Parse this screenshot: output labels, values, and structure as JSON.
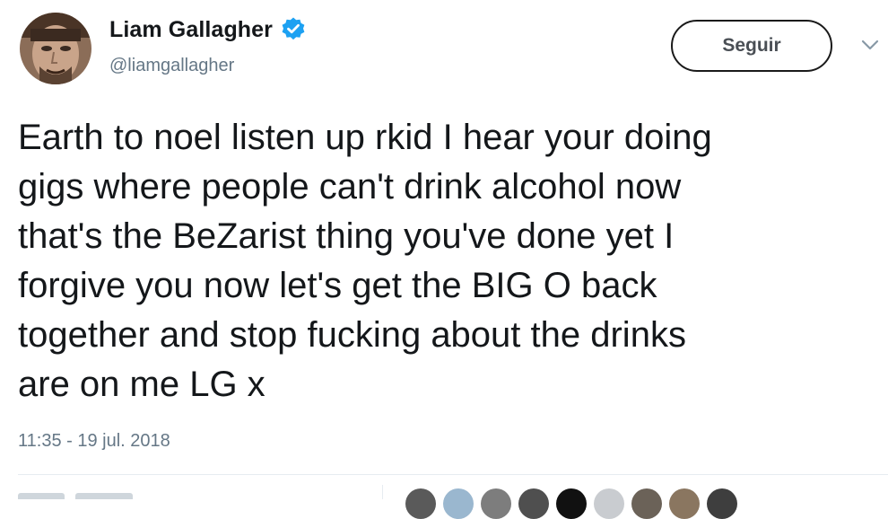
{
  "tweet": {
    "display_name": "Liam Gallagher",
    "handle": "@liamgallagher",
    "follow_label": "Seguir",
    "text": "Earth to noel listen up rkid I hear your doing\ngigs where people can't drink alcohol now\nthat's the BeZarist thing you've done yet I\nforgive you now let's get the BIG O back\ntogether and stop fucking about the drinks\nare on me LG x",
    "timestamp": "11:35 - 19 jul. 2018"
  },
  "icons": {
    "verified": "verified-badge-icon",
    "more": "chevron-down-icon"
  },
  "colors": {
    "verified_blue": "#1da1f2",
    "secondary_text": "#657786",
    "primary_text": "#14171a"
  },
  "likers": [
    {
      "color": "#5a5a5a"
    },
    {
      "color": "#9ab7cf"
    },
    {
      "color": "#7d7d7d"
    },
    {
      "color": "#4f4f4f"
    },
    {
      "color": "#111111"
    },
    {
      "color": "#c9ccd0"
    },
    {
      "color": "#6b6258"
    },
    {
      "color": "#8a7660"
    },
    {
      "color": "#3e3e3e"
    }
  ]
}
